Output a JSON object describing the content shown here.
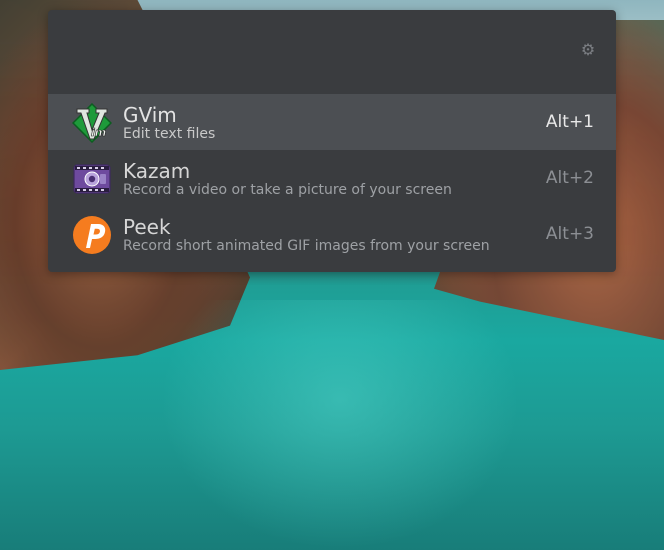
{
  "launcher": {
    "search": {
      "value": "",
      "placeholder": ""
    },
    "preferences_icon": "gear-icon",
    "results": [
      {
        "name": "GVim",
        "description": "Edit text files",
        "shortcut": "Alt+1",
        "icon": "vim-icon",
        "selected": true
      },
      {
        "name": "Kazam",
        "description": "Record a video or take a picture of your screen",
        "shortcut": "Alt+2",
        "icon": "kazam-icon",
        "selected": false
      },
      {
        "name": "Peek",
        "description": "Record short animated GIF images from your screen",
        "shortcut": "Alt+3",
        "icon": "peek-icon",
        "selected": false
      }
    ]
  },
  "colors": {
    "panel_bg": "#3a3c3f",
    "selected_bg": "#4c4f53",
    "vim_green": "#1e9a3a",
    "peek_orange": "#f57c1f",
    "kazam_purple": "#6e4a9e"
  }
}
